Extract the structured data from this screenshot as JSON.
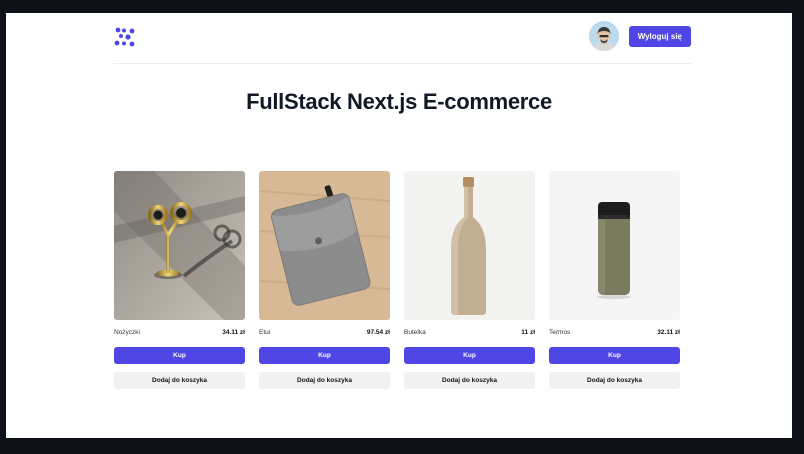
{
  "header": {
    "logo_icon": "dots-logo-icon",
    "avatar_icon": "user-avatar-icon",
    "logout_label": "Wyloguj się",
    "accent_color": "#4f46e5"
  },
  "page": {
    "title": "FullStack Next.js E-commerce"
  },
  "products": [
    {
      "name": "Nożyczki",
      "price": "34.11 zł",
      "buy_label": "Kup",
      "cart_label": "Dodaj do koszyka",
      "image_icon": "scissors-image"
    },
    {
      "name": "Etui",
      "price": "97.54 zł",
      "buy_label": "Kup",
      "cart_label": "Dodaj do koszyka",
      "image_icon": "felt-pouch-image"
    },
    {
      "name": "Butelka",
      "price": "11 zł",
      "buy_label": "Kup",
      "cart_label": "Dodaj do koszyka",
      "image_icon": "bottle-image"
    },
    {
      "name": "Termos",
      "price": "32.11 zł",
      "buy_label": "Kup",
      "cart_label": "Dodaj do koszyka",
      "image_icon": "thermos-image"
    }
  ]
}
